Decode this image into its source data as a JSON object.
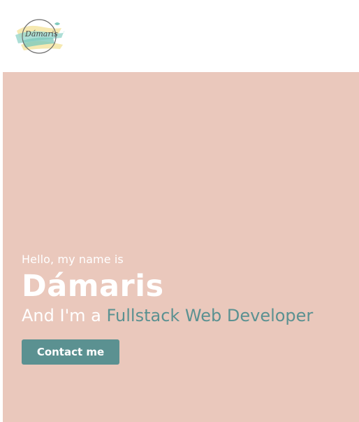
{
  "header": {
    "logo_text": "Dámaris"
  },
  "hero": {
    "greeting": "Hello, my name is",
    "name": "Dámaris",
    "role_prefix": "And I'm a",
    "role_highlight": "Fullstack Web Developer",
    "contact_label": "Contact me"
  },
  "colors": {
    "hero_background": "#eac8bc",
    "accent": "#5b9191",
    "text_light": "#ffffff"
  }
}
